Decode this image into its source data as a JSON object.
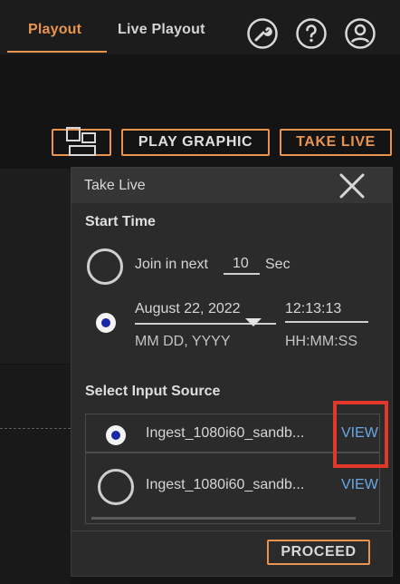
{
  "nav": {
    "tabs": [
      {
        "label": "Playout",
        "active": true
      },
      {
        "label": "Live Playout",
        "active": false
      }
    ],
    "icons": [
      "settings-wrench-icon",
      "help-icon",
      "user-account-icon"
    ]
  },
  "toolbar": {
    "layout_icon": "layout-icon",
    "play_graphic_label": "PLAY GRAPHIC",
    "take_live_label": "TAKE LIVE"
  },
  "modal": {
    "title": "Take Live",
    "start_time": {
      "title": "Start Time",
      "join_prefix": "Join in next",
      "join_value": "10",
      "join_unit": "Sec",
      "date_value": "August 22, 2022",
      "date_format": "MM DD, YYYY",
      "time_value": "12:13:13",
      "time_format": "HH:MM:SS",
      "selected_option": "date"
    },
    "input_source": {
      "title": "Select Input Source",
      "items": [
        {
          "name": "Ingest_1080i60_sandb...",
          "action": "VIEW",
          "selected": true
        },
        {
          "name": "Ingest_1080i60_sandb...",
          "action": "VIEW",
          "selected": false
        }
      ]
    },
    "proceed_label": "PROCEED"
  },
  "colors": {
    "accent": "#e8944e",
    "link": "#6aa8e6",
    "highlight": "#e2382a",
    "radio_fill": "#1c27a8"
  }
}
